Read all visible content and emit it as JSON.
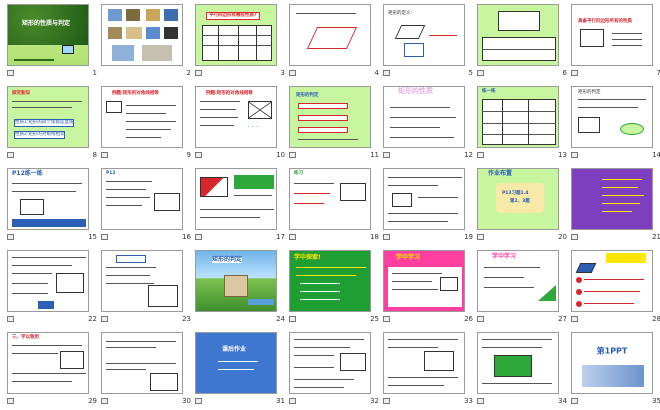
{
  "slides": [
    {
      "num": "1",
      "title": "矩形的性质与判定"
    },
    {
      "num": "2"
    },
    {
      "num": "3",
      "title": "平行四边形有哪些性质?"
    },
    {
      "num": "4"
    },
    {
      "num": "5",
      "title": "矩形的定义:"
    },
    {
      "num": "6"
    },
    {
      "num": "7",
      "title": "具备平行四边形所有的性质"
    },
    {
      "num": "8",
      "title": "探究新知",
      "line1": "性质1:矩形的四个角都是直角",
      "line2": "性质2:矩形的对角线相等"
    },
    {
      "num": "9",
      "title": "例题:矩形的对角线相等"
    },
    {
      "num": "10",
      "title": "例题:矩形的对角线相等"
    },
    {
      "num": "11",
      "title": "矩形的判定"
    },
    {
      "num": "12",
      "title": "矩形的性质"
    },
    {
      "num": "13",
      "title": "练一练"
    },
    {
      "num": "14",
      "title": "矩形的判定"
    },
    {
      "num": "15",
      "title": "P12练一练"
    },
    {
      "num": "16",
      "title": "P12"
    },
    {
      "num": "17"
    },
    {
      "num": "18",
      "title": "练习"
    },
    {
      "num": "19"
    },
    {
      "num": "20",
      "title": "作业布置",
      "line1": "P13习题1.4",
      "line2": "第2、3题"
    },
    {
      "num": "21"
    },
    {
      "num": "22"
    },
    {
      "num": "23"
    },
    {
      "num": "24",
      "title": "矩形的判定"
    },
    {
      "num": "25",
      "title": "学中探索!"
    },
    {
      "num": "26",
      "title": "学中学习"
    },
    {
      "num": "27",
      "title": "学中学习"
    },
    {
      "num": "28"
    },
    {
      "num": "29",
      "title": "三、学以致用"
    },
    {
      "num": "30"
    },
    {
      "num": "31",
      "title": "课后作业"
    },
    {
      "num": "32"
    },
    {
      "num": "33"
    },
    {
      "num": "34"
    },
    {
      "num": "35",
      "title": "第1PPT"
    }
  ],
  "colors": {
    "green": "#2ea83a",
    "red": "#d8262c",
    "blue": "#2c5fb3",
    "pink": "#ff3fa0",
    "purple": "#7e3fbf",
    "yellow": "#ffe600",
    "lightgreen": "#c8f5a0"
  }
}
